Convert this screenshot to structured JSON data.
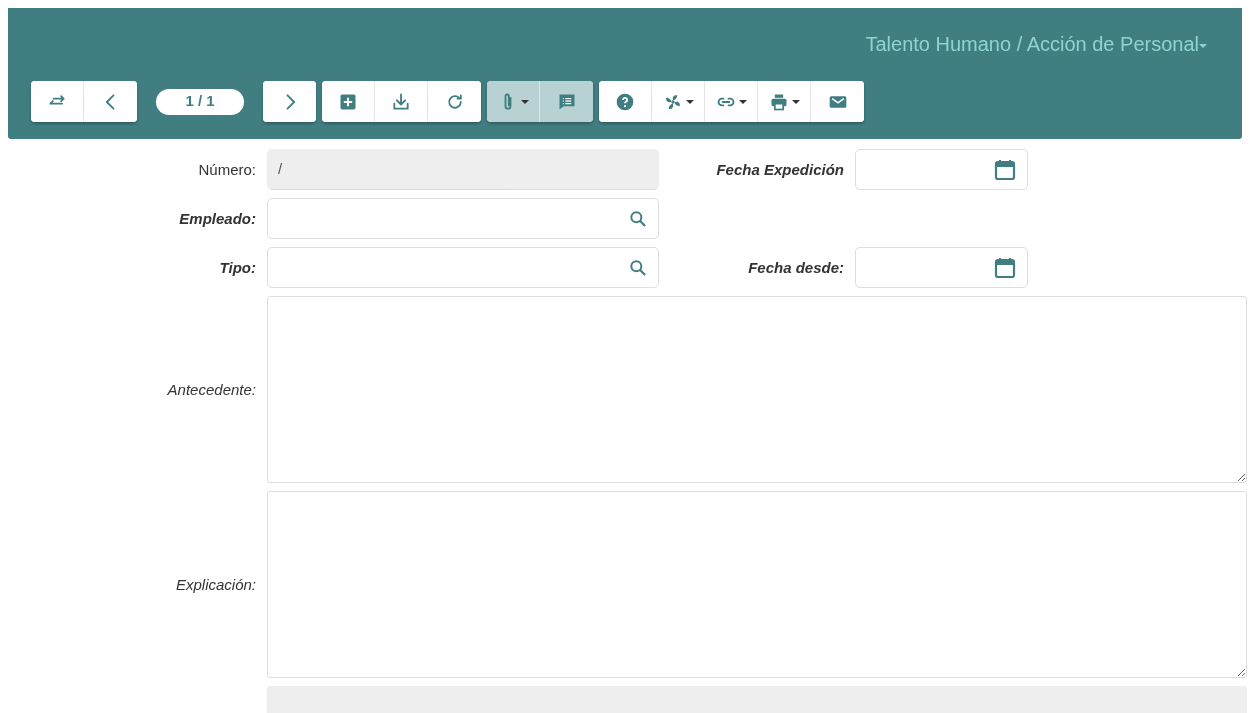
{
  "header": {
    "breadcrumb": "Talento Humano / Acción de Personal",
    "breadcrumb_dropdown": true
  },
  "toolbar": [
    {
      "kind": "group",
      "buttons": [
        {
          "active": false,
          "dropdown": false
        },
        {
          "active": false,
          "dropdown": false
        }
      ]
    },
    {
      "kind": "pager",
      "text": "1 / 1"
    },
    {
      "kind": "group",
      "buttons": [
        {
          "active": false,
          "dropdown": false
        }
      ]
    },
    {
      "kind": "group",
      "buttons": [
        {
          "active": false,
          "dropdown": false
        },
        {
          "active": false,
          "dropdown": false
        },
        {
          "active": false,
          "dropdown": false
        }
      ]
    },
    {
      "kind": "group",
      "buttons": [
        {
          "active": true,
          "dropdown": true
        },
        {
          "active": true,
          "dropdown": false
        }
      ]
    },
    {
      "kind": "group",
      "buttons": [
        {
          "active": false,
          "dropdown": false
        },
        {
          "active": false,
          "dropdown": true
        },
        {
          "active": false,
          "dropdown": true
        },
        {
          "active": false,
          "dropdown": true
        },
        {
          "active": false,
          "dropdown": false
        }
      ]
    }
  ],
  "rows": [
    {
      "left": {
        "label": "Número:",
        "required": false,
        "kind": "text",
        "readonly": true,
        "value": "/"
      },
      "right": {
        "label": "Fecha Expedición",
        "required": true,
        "kind": "date",
        "readonly": false
      }
    },
    {
      "left": {
        "label": "Empleado:",
        "required": true,
        "kind": "lookup",
        "readonly": false
      }
    },
    {
      "left": {
        "label": "Tipo:",
        "required": true,
        "kind": "lookup",
        "readonly": false
      },
      "right": {
        "label": "Fecha desde:",
        "required": true,
        "kind": "date",
        "readonly": false
      }
    },
    {
      "left": {
        "label": "Antecedente:",
        "required": false,
        "kind": "textarea"
      }
    },
    {
      "left": {
        "label": "Explicación:",
        "required": false,
        "kind": "textarea"
      }
    },
    {
      "left": {
        "kind": "bar",
        "readonly": true
      }
    }
  ]
}
